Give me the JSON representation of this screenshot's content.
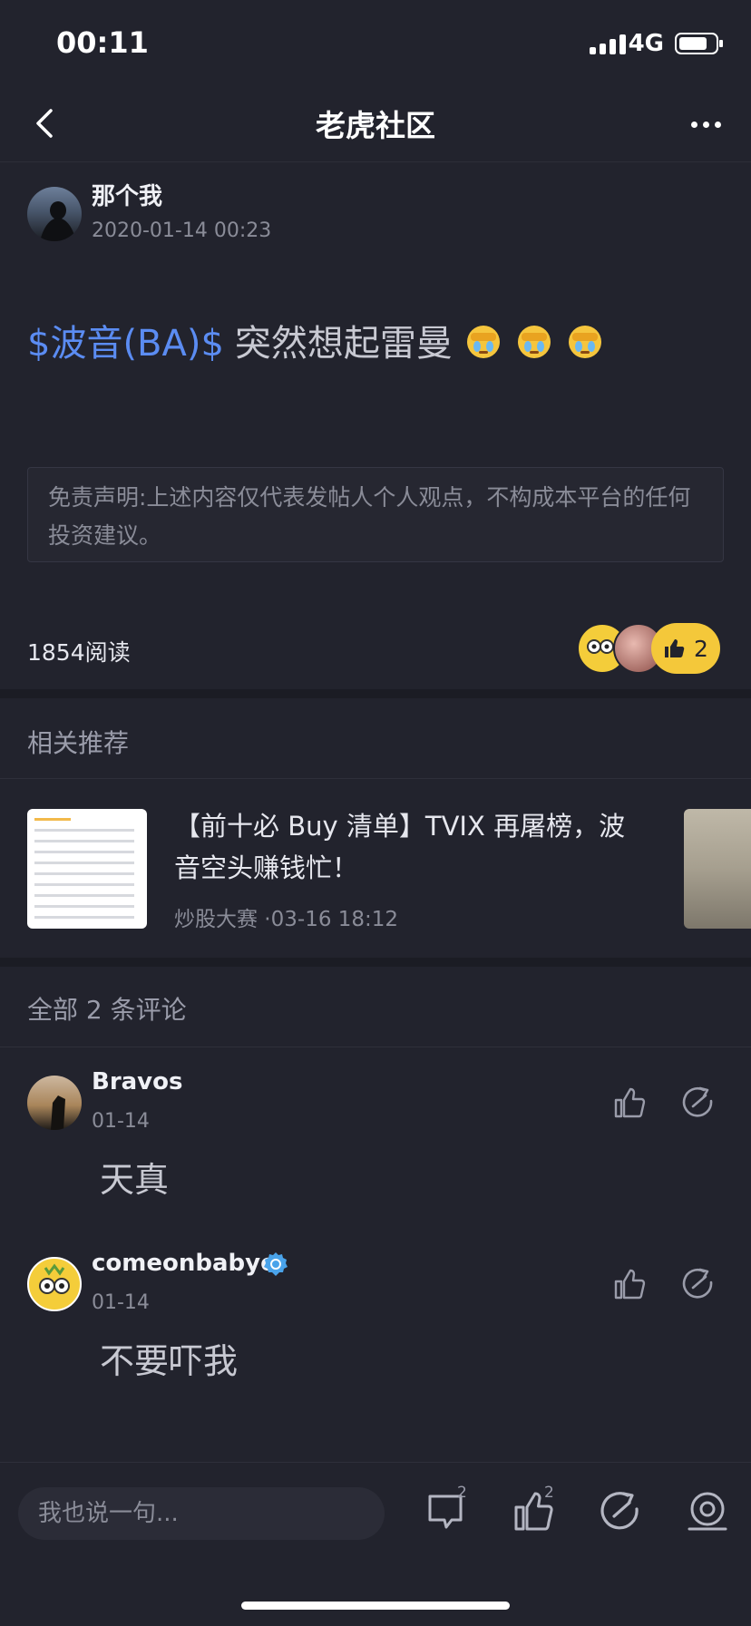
{
  "status": {
    "time": "00:11",
    "network": "4G"
  },
  "nav": {
    "title": "老虎社区"
  },
  "post": {
    "author": "那个我",
    "date": "2020-01-14 00:23",
    "stock_tag": "$波音(BA)$",
    "text": "突然想起雷曼",
    "disclaimer": "免责声明:上述内容仅代表发帖人个人观点，不构成本平台的任何投资建议。",
    "reads": "1854阅读",
    "like_count": "2"
  },
  "recommend": {
    "section_title": "相关推荐",
    "items": [
      {
        "title": "【前十必 Buy 清单】TVIX 再屠榜，波音空头赚钱忙！",
        "meta": "炒股大赛 ·03-16 18:12"
      }
    ]
  },
  "comments": {
    "section_title": "全部 2 条评论",
    "items": [
      {
        "name": "Bravos",
        "date": "01-14",
        "text": "天真"
      },
      {
        "name": "comeonbabye",
        "date": "01-14",
        "text": "不要吓我"
      }
    ]
  },
  "bottom": {
    "placeholder": "我也说一句...",
    "comment_count": "2",
    "like_count": "2"
  },
  "colors": {
    "accent": "#5b8cf2",
    "like": "#f4c83a",
    "background": "#22232d"
  }
}
